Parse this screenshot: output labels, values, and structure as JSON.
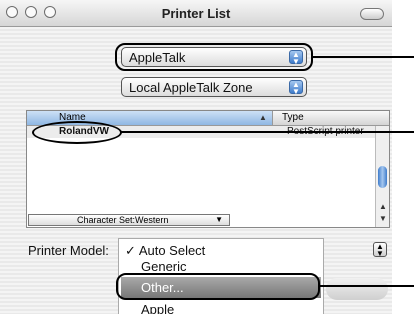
{
  "window": {
    "title": "Printer List"
  },
  "connection_popup": {
    "value": "AppleTalk"
  },
  "zone_popup": {
    "value": "Local AppleTalk Zone"
  },
  "printer_list": {
    "columns": [
      "Name",
      "Type"
    ],
    "rows": [
      {
        "name": "RolandVW",
        "type": "PostScript printer"
      }
    ],
    "charset_label": "Character Set:Western"
  },
  "printer_model": {
    "label": "Printer Model:",
    "menu_items": [
      "Auto Select",
      "Generic",
      "Other...",
      "Apple"
    ],
    "checked_marker": "✓"
  },
  "icons": [
    "stepper-arrows-icon",
    "checkmark-icon",
    "sort-triangle-icon",
    "dropdown-triangle-icon"
  ],
  "colors": {
    "accent": "#3f7ccb",
    "highlight": "#8a8a8a",
    "annotation": "#000000"
  }
}
